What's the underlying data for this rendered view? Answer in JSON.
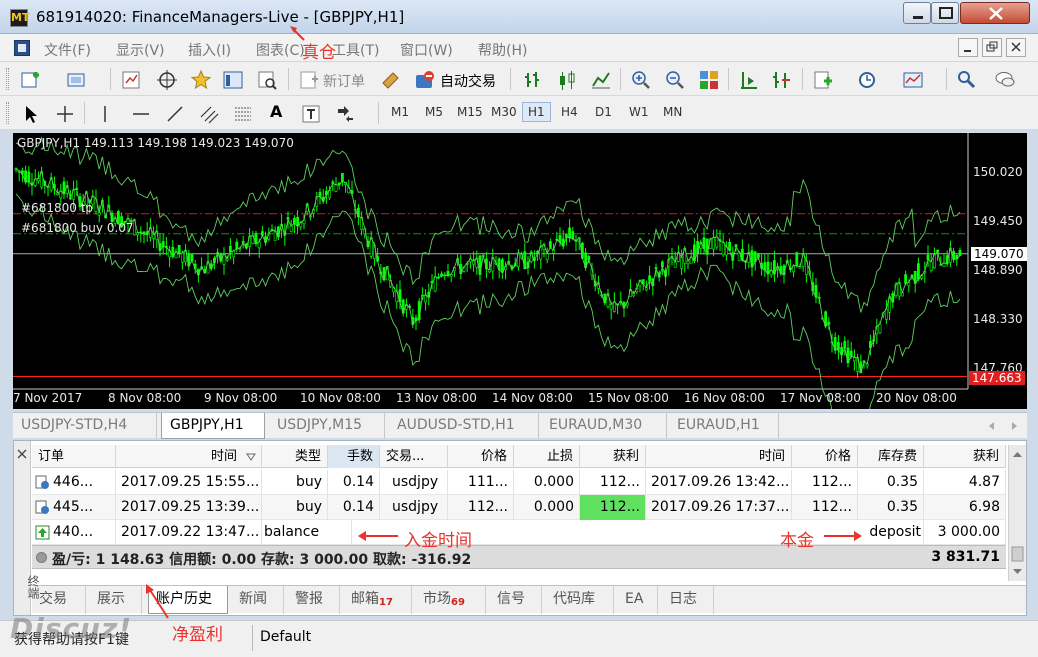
{
  "window": {
    "title": "681914020: FinanceManagers-Live - [GBPJPY,H1]",
    "logo": "MT",
    "min_icon": "minimize-icon",
    "max_icon": "maximize-icon",
    "close_icon": "close-icon"
  },
  "menu": {
    "items": [
      "文件(F)",
      "显示(V)",
      "插入(I)",
      "图表(C)",
      "工具(T)",
      "窗口(W)",
      "帮助(H)"
    ]
  },
  "toolbar": {
    "new_order": "新订单",
    "auto_trading": "自动交易"
  },
  "timeframes": [
    "M1",
    "M5",
    "M15",
    "M30",
    "H1",
    "H4",
    "D1",
    "W1",
    "MN"
  ],
  "active_timeframe": "H1",
  "chart": {
    "header": "GBPJPY,H1  149.113 149.198 149.023 149.070",
    "tp_label": "#681800 tp",
    "buy_label": "#681800 buy 0.07",
    "price_ticks": [
      "150.020",
      "149.450",
      "149.070",
      "148.890",
      "148.330",
      "147.760",
      "147.663"
    ],
    "current_price": "149.070",
    "low_marker": "147.663",
    "time_ticks": [
      "7 Nov 2017",
      "8 Nov 08:00",
      "9 Nov 08:00",
      "10 Nov 08:00",
      "13 Nov 08:00",
      "14 Nov 08:00",
      "15 Nov 08:00",
      "16 Nov 08:00",
      "17 Nov 08:00",
      "20 Nov 08:00"
    ],
    "colors": {
      "candle": "#00ff00",
      "bands": "#5fcf5f",
      "tp_line": "#d02020",
      "buy_line": "#00a000",
      "price_line": "#aaaaaa",
      "low_line": "#ff2020"
    }
  },
  "chart_tabs": [
    "USDJPY-STD,H4",
    "GBPJPY,H1",
    "USDJPY,M15",
    "AUDUSD-STD,H1",
    "EURAUD,M30",
    "EURAUD,H1"
  ],
  "active_chart_tab": "GBPJPY,H1",
  "history": {
    "columns": [
      "订单",
      "时间",
      "类型",
      "手数",
      "交易...",
      "价格",
      "止损",
      "获利",
      "时间",
      "价格",
      "库存费",
      "获利"
    ],
    "rows": [
      {
        "icon": "order-history-icon",
        "order": "446...",
        "open_time": "2017.09.25 15:55...",
        "type": "buy",
        "lots": "0.14",
        "symbol": "usdjpy",
        "price": "111...",
        "sl": "0.000",
        "tp": "112...",
        "close_time": "2017.09.26 13:42...",
        "close_price": "112...",
        "swap": "0.35",
        "profit": "4.87"
      },
      {
        "icon": "order-history-icon",
        "order": "445...",
        "open_time": "2017.09.25 13:39...",
        "type": "buy",
        "lots": "0.14",
        "symbol": "usdjpy",
        "price": "112...",
        "sl": "0.000",
        "tp": "112...",
        "close_time": "2017.09.26 17:37...",
        "close_price": "112...",
        "swap": "0.35",
        "profit": "6.98"
      },
      {
        "icon": "deposit-arrow-icon",
        "order": "440...",
        "open_time": "2017.09.22 13:47...",
        "type": "balance",
        "comment": "deposit",
        "profit": "3 000.00"
      }
    ],
    "summary": "盈/亏: 1 148.63  信用额: 0.00  存款: 3 000.00  取款: -316.92",
    "total": "3 831.71"
  },
  "terminal_tabs": [
    {
      "label": "交易"
    },
    {
      "label": "展示"
    },
    {
      "label": "账户历史",
      "active": true
    },
    {
      "label": "新闻"
    },
    {
      "label": "警报"
    },
    {
      "label": "邮箱",
      "badge": "17"
    },
    {
      "label": "市场",
      "badge": "69"
    },
    {
      "label": "信号"
    },
    {
      "label": "代码库"
    },
    {
      "label": "EA"
    },
    {
      "label": "日志"
    }
  ],
  "terminal_side_label": "终端",
  "status": {
    "help": "获得帮助请按F1键",
    "profile": "Default"
  },
  "watermark": "Discuz!",
  "annotations": {
    "real_account": "真仓",
    "deposit_time": "入金时间",
    "principal": "本金",
    "net_profit": "净盈利",
    "color": "#e8342c"
  }
}
